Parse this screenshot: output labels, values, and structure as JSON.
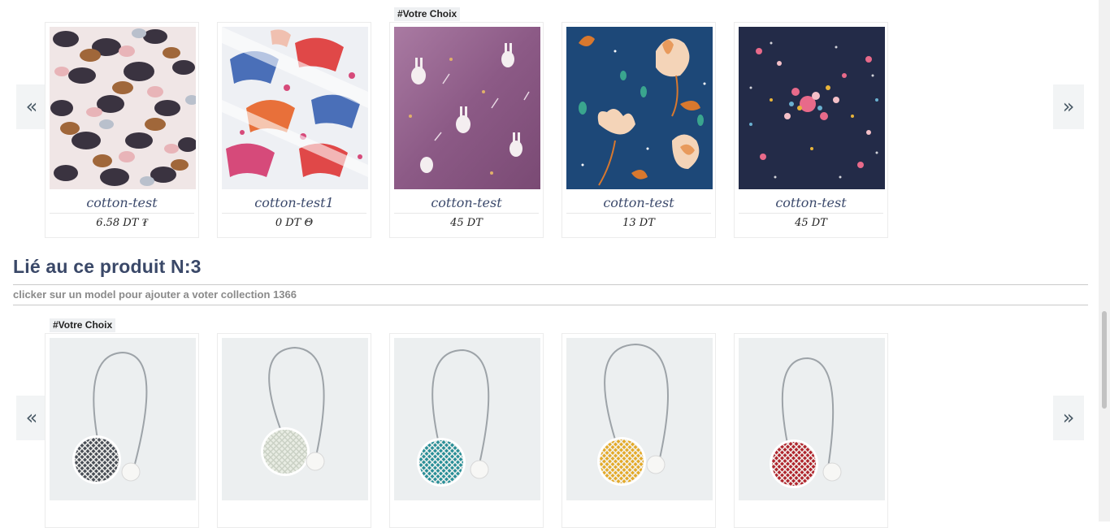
{
  "carousel_top": {
    "prev_label": "«",
    "next_label": "»",
    "badge": "#Votre Choix",
    "badge_index": 2,
    "items": [
      {
        "name": "cotton-test",
        "price": "6.58 DT ₮"
      },
      {
        "name": "cotton-test1",
        "price": "0 DT Θ"
      },
      {
        "name": "cotton-test",
        "price": "45 DT"
      },
      {
        "name": "cotton-test",
        "price": "13 DT"
      },
      {
        "name": "cotton-test",
        "price": "45 DT"
      }
    ]
  },
  "related_section": {
    "title": "Lié au ce produit N:3",
    "subtitle": "clicker sur un model pour ajouter a voter collection 1366"
  },
  "carousel_bottom": {
    "prev_label": "«",
    "next_label": "»",
    "badge": "#Votre Choix",
    "badge_index": 0,
    "items": [
      {
        "disc_color": "#4a4f57"
      },
      {
        "disc_color": "#e8ece3"
      },
      {
        "disc_color": "#2a8f98"
      },
      {
        "disc_color": "#e4aa2a"
      },
      {
        "disc_color": "#b0262e"
      }
    ]
  },
  "colors": {
    "title": "#3a4868",
    "product_name": "#3c4a6c",
    "nav_bg": "#f2f4f5"
  },
  "icons": {
    "prev": "chevron-double-left",
    "next": "chevron-double-right"
  }
}
